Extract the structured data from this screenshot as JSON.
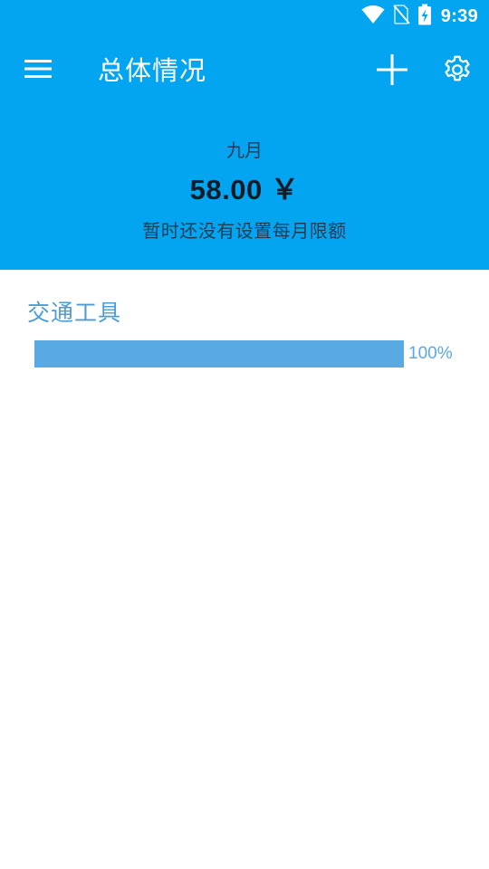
{
  "status_bar": {
    "time": "9:39",
    "icons": [
      "wifi-icon",
      "no-sim-icon",
      "battery-charging-icon"
    ]
  },
  "toolbar": {
    "title": "总体情况",
    "menu_icon": "menu-icon",
    "add_icon": "add-icon",
    "settings_icon": "gear-icon"
  },
  "summary": {
    "month": "九月",
    "amount": "58.00 ￥",
    "limit_text": "暂时还没有设置每月限额"
  },
  "categories": [
    {
      "name": "交通工具",
      "percent": 100,
      "percent_label": "100%"
    }
  ],
  "colors": {
    "header_bg": "#03A5F1",
    "accent": "#59A9E3",
    "category_text": "#4C9DD6"
  }
}
